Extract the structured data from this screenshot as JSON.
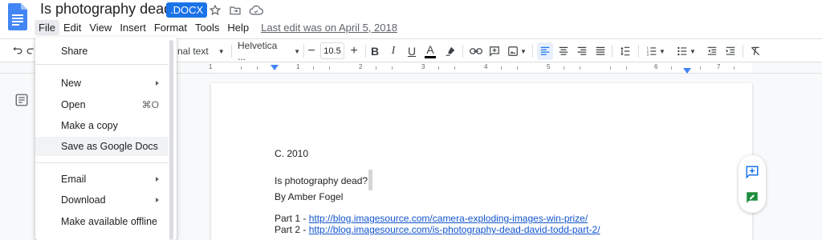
{
  "header": {
    "doc_title": "Is photography dead?",
    "badge": ".DOCX",
    "last_edit": "Last edit was on April 5, 2018",
    "icons": [
      "star-icon",
      "move-to-folder-icon",
      "cloud-status-icon"
    ]
  },
  "menubar": {
    "items": [
      "File",
      "Edit",
      "View",
      "Insert",
      "Format",
      "Tools",
      "Help"
    ],
    "active": "File"
  },
  "toolbar": {
    "style_value": "nal text",
    "font_value": "Helvetica ...",
    "font_size": "10.5",
    "minus": "−",
    "plus": "+",
    "bold": "B",
    "italic": "I",
    "underline": "U",
    "text_color": "A",
    "accent_color": "#1a73e8"
  },
  "ruler": {
    "numbers": [
      "1",
      "1",
      "2",
      "3",
      "4",
      "5",
      "6",
      "7"
    ]
  },
  "file_menu": {
    "items": [
      {
        "label": "Share",
        "shortcut": "",
        "submenu": false
      },
      {
        "label": "New",
        "shortcut": "",
        "submenu": true
      },
      {
        "label": "Open",
        "shortcut": "⌘O",
        "submenu": false
      },
      {
        "label": "Make a copy",
        "shortcut": "",
        "submenu": false
      },
      {
        "label": "Save as Google Docs",
        "shortcut": "",
        "submenu": false
      },
      {
        "label": "Email",
        "shortcut": "",
        "submenu": true
      },
      {
        "label": "Download",
        "shortcut": "",
        "submenu": true
      },
      {
        "label": "Make available offline",
        "shortcut": "",
        "submenu": false
      }
    ],
    "hovered": "Save as Google Docs"
  },
  "document": {
    "line1": "C. 2010",
    "line2": "Is photography dead?",
    "line3": "By Amber Fogel",
    "part1_prefix": "Part 1 - ",
    "part1_link": "http://blog.imagesource.com/camera-exploding-images-win-prize/",
    "part2_prefix": "Part 2 - ",
    "part2_link": "http://blog.imagesource.com/is-photography-dead-david-todd-part-2/"
  }
}
